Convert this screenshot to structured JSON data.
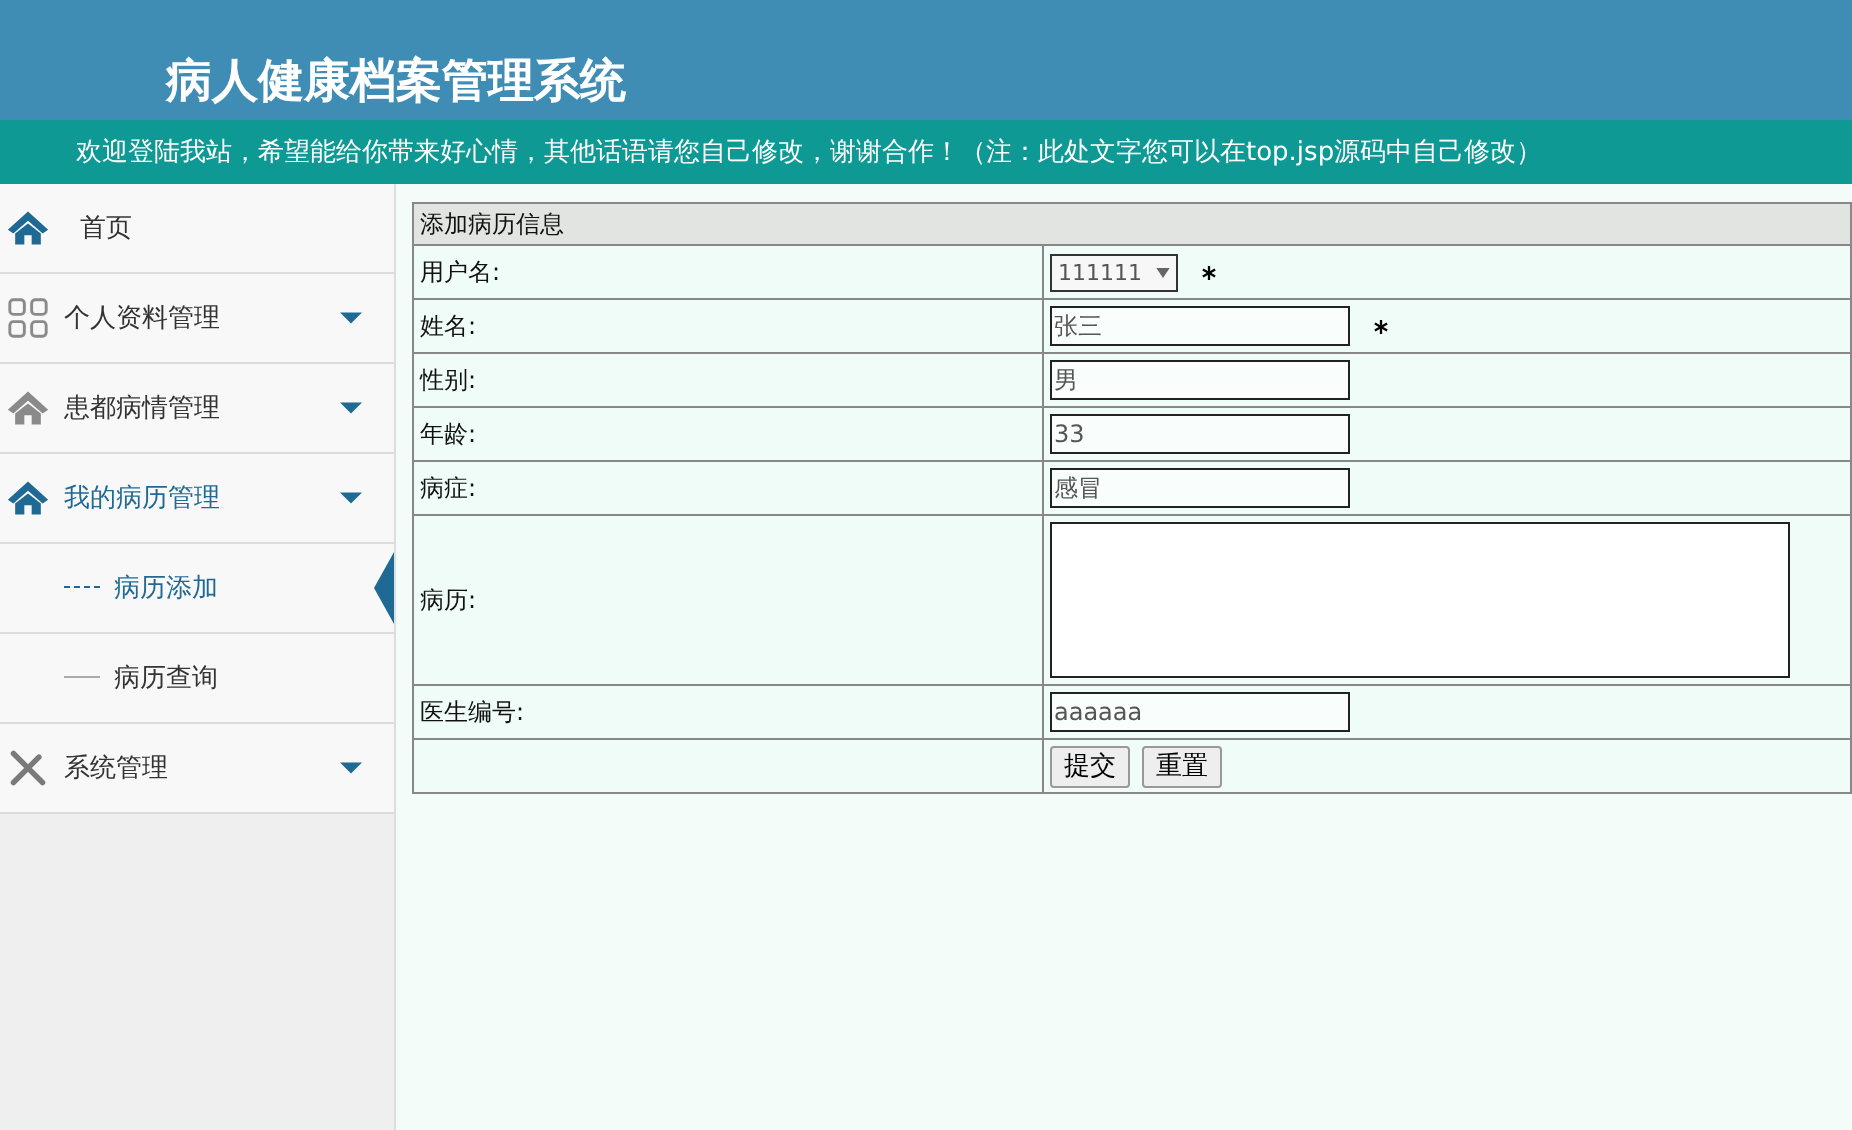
{
  "header": {
    "title": "病人健康档案管理系统"
  },
  "notice": "欢迎登陆我站，希望能给你带来好心情，其他话语请您自己修改，谢谢合作！（注：此处文字您可以在top.jsp源码中自己修改）",
  "sidebar": {
    "items": [
      {
        "label": "首页",
        "kind": "link",
        "expanded": false
      },
      {
        "label": "个人资料管理",
        "kind": "menu",
        "expanded": false
      },
      {
        "label": "患都病情管理",
        "kind": "menu",
        "expanded": false
      },
      {
        "label": "我的病历管理",
        "kind": "menu",
        "expanded": true,
        "children": [
          {
            "label": "病历添加",
            "selected": true
          },
          {
            "label": "病历查询",
            "selected": false
          }
        ]
      },
      {
        "label": "系统管理",
        "kind": "menu",
        "expanded": false
      }
    ]
  },
  "form": {
    "title": "添加病历信息",
    "rows": [
      {
        "label": "用户名:",
        "kind": "select",
        "value": "111111",
        "required": true
      },
      {
        "label": "姓名:",
        "kind": "text",
        "value": "张三",
        "required": true
      },
      {
        "label": "性别:",
        "kind": "text",
        "value": "男",
        "required": false
      },
      {
        "label": "年龄:",
        "kind": "text",
        "value": "33",
        "required": false
      },
      {
        "label": "病症:",
        "kind": "text",
        "value": "感冒",
        "required": false
      },
      {
        "label": "病历:",
        "kind": "textarea",
        "value": "",
        "required": false
      },
      {
        "label": "医生编号:",
        "kind": "text",
        "value": "aaaaaa",
        "required": false
      }
    ],
    "buttons": [
      "提交",
      "重置"
    ]
  }
}
